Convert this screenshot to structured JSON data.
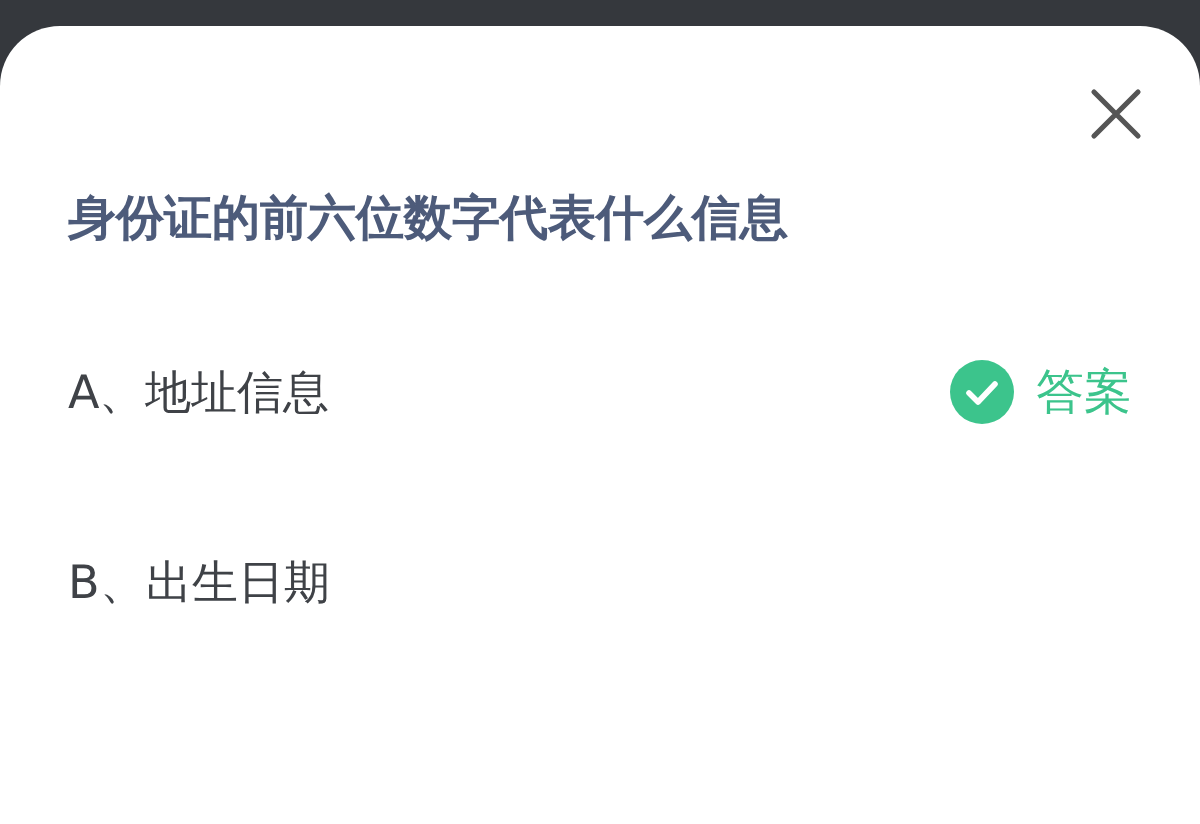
{
  "question": "身份证的前六位数字代表什么信息",
  "options": [
    {
      "label": "A、地址信息",
      "correct": true,
      "badge": "答案"
    },
    {
      "label": "B、出生日期",
      "correct": false
    }
  ]
}
